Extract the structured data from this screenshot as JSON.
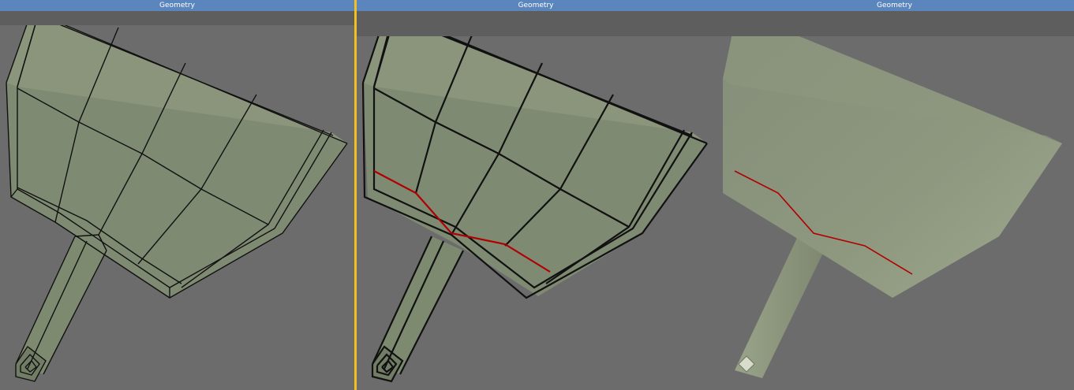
{
  "viewports": [
    {
      "title": "Geometry",
      "mode": "wireframe",
      "active": false
    },
    {
      "title": "Geometry",
      "mode": "wireframe",
      "active": true,
      "edge_highlight_color": "#b00000"
    },
    {
      "title": "Geometry",
      "mode": "shaded",
      "active": false,
      "edge_highlight_color": "#b00000"
    }
  ],
  "colors": {
    "background": "#6c6c6c",
    "header": "#5b86bd",
    "active_border": "#f2c020",
    "mesh_fill": "#86917a",
    "wire": "#111111",
    "selected_edge": "#b00000"
  },
  "icons": {
    "handle_tip": "diamond-icon"
  }
}
